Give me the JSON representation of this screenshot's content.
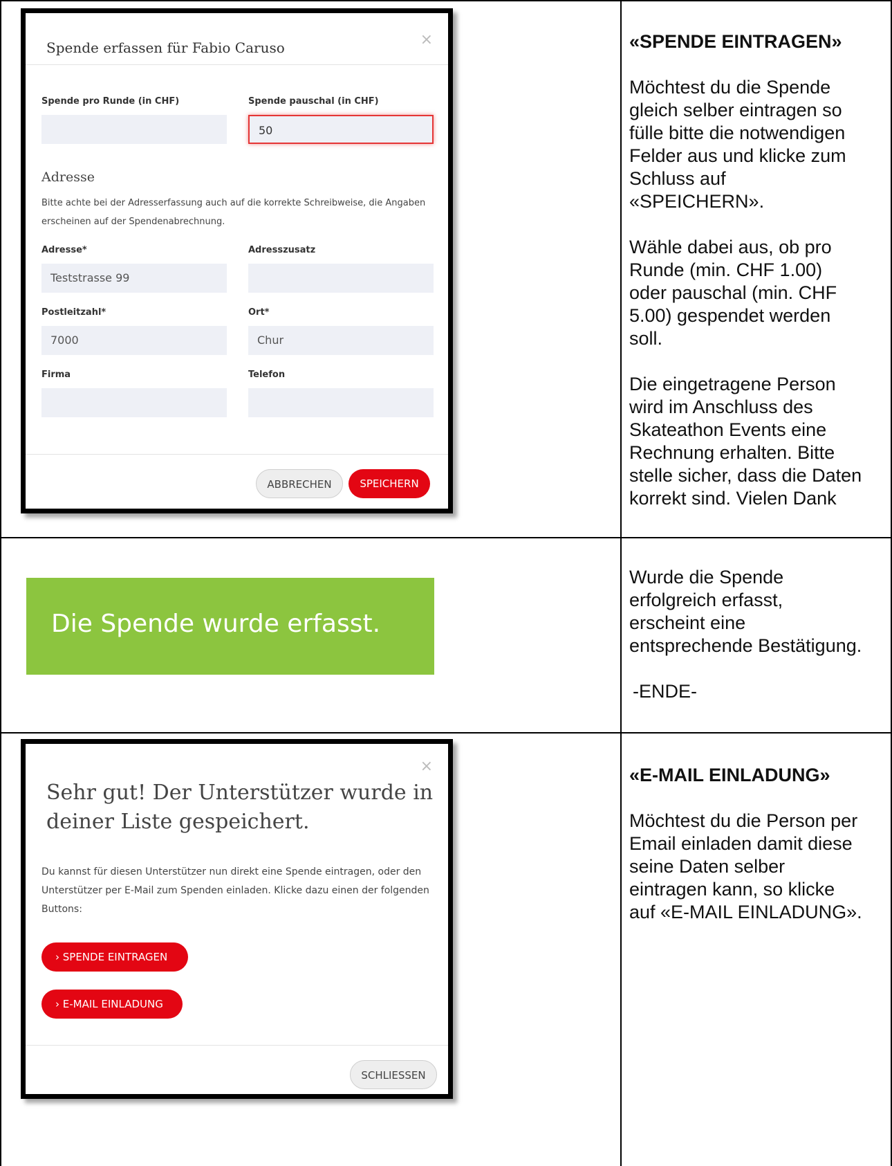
{
  "row1": {
    "modal": {
      "title": "Spende erfassen für Fabio Caruso",
      "close": "×",
      "fields": {
        "per_round_label": "Spende pro Runde (in CHF)",
        "per_round_value": "",
        "lump_label": "Spende pauschal (in CHF)",
        "lump_value": "50"
      },
      "address_heading": "Adresse",
      "address_help": "Bitte achte bei der Adresserfassung auch auf die korrekte Schreibweise, die Angaben erscheinen auf der Spendenabrechnung.",
      "address": {
        "street_label": "Adresse*",
        "street_value": "Teststrasse 99",
        "extra_label": "Adresszusatz",
        "extra_value": "",
        "zip_label": "Postleitzahl*",
        "zip_value": "7000",
        "city_label": "Ort*",
        "city_value": "Chur",
        "company_label": "Firma",
        "company_value": "",
        "phone_label": "Telefon",
        "phone_value": ""
      },
      "cancel_label": "ABBRECHEN",
      "save_label": "SPEICHERN"
    },
    "text": {
      "heading": "«SPENDE EINTRAGEN»",
      "p1": "Möchtest du die Spende\ngleich selber eintragen so\nfülle bitte die notwendigen\nFelder aus und klicke zum\nSchluss auf\n«SPEICHERN».",
      "p2": "Wähle dabei aus, ob pro\nRunde (min. CHF 1.00)\noder pauschal (min. CHF\n5.00) gespendet werden\nsoll.",
      "p3": "Die eingetragene Person\nwird im Anschluss des\nSkateathon Events eine\nRechnung erhalten. Bitte\nstelle sicher, dass die Daten\nkorrekt sind. Vielen Dank"
    }
  },
  "row2": {
    "banner": "Die Spende wurde erfasst.",
    "banner_color": "#8cc53f",
    "text": {
      "p1": "Wurde die Spende\nerfolgreich erfasst,\nerscheint eine\nentsprechende Bestätigung.",
      "p2": "-ENDE-"
    }
  },
  "row3": {
    "modal": {
      "close": "×",
      "heading": "Sehr gut! Der Unterstützer wurde in deiner Liste gespeichert.",
      "body": "Du kannst für diesen Unterstützer nun direkt eine Spende eintragen, oder den Unterstützer per E-Mail zum Spenden einladen. Klicke dazu einen der folgenden Buttons:",
      "donate_button": "›  SPENDE EINTRAGEN",
      "email_button": "›  E-MAIL EINLADUNG",
      "close_button": "SCHLIESSEN"
    },
    "text": {
      "heading": "«E-MAIL EINLADUNG»",
      "p1": "Möchtest du die Person per\nEmail einladen damit diese\nseine Daten selber\neintragen kann, so klicke\nauf «E-MAIL EINLADUNG»."
    }
  },
  "colors": {
    "accent": "#e30613",
    "success": "#8cc53f"
  }
}
